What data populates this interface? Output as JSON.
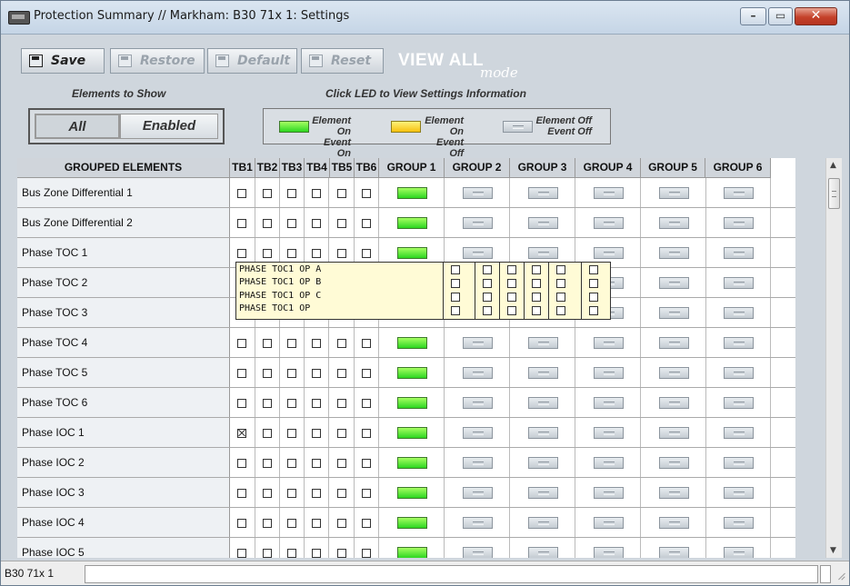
{
  "window": {
    "title": "Protection Summary // Markham: B30 71x 1: Settings",
    "controls": {
      "minimize_icon": "minimize-icon",
      "maximize_icon": "maximize-icon",
      "close_icon": "close-icon"
    }
  },
  "toolbar": {
    "save_label": "Save",
    "restore_label": "Restore",
    "default_label": "Default",
    "reset_label": "Reset",
    "view_all": "VIEW ALL",
    "view_all_mode": "mode"
  },
  "elements_to_show": {
    "label": "Elements to Show",
    "all_label": "All",
    "enabled_label": "Enabled",
    "selected": "All"
  },
  "legend": {
    "header": "Click LED to View Settings Information",
    "items": [
      {
        "line1": "Element On",
        "line2": "Event On",
        "color": "#3bdc2a"
      },
      {
        "line1": "Element On",
        "line2": "Event Off",
        "color": "#f6c10d"
      },
      {
        "line1": "Element Off",
        "line2": "Event Off",
        "color": "#c4cbd2"
      }
    ]
  },
  "table": {
    "columns": {
      "name": "GROUPED ELEMENTS",
      "tb": [
        "TB1",
        "TB2",
        "TB3",
        "TB4",
        "TB5",
        "TB6"
      ],
      "groups": [
        "GROUP 1",
        "GROUP 2",
        "GROUP 3",
        "GROUP 4",
        "GROUP 5",
        "GROUP 6"
      ]
    },
    "rows": [
      {
        "name": "Bus Zone Differential 1",
        "tb_checked": [
          false,
          false,
          false,
          false,
          false,
          false
        ],
        "group_state": [
          "on",
          "off",
          "off",
          "off",
          "off",
          "off"
        ]
      },
      {
        "name": "Bus Zone Differential 2",
        "tb_checked": [
          false,
          false,
          false,
          false,
          false,
          false
        ],
        "group_state": [
          "on",
          "off",
          "off",
          "off",
          "off",
          "off"
        ]
      },
      {
        "name": "Phase TOC 1",
        "tb_checked": [
          false,
          false,
          false,
          false,
          false,
          false
        ],
        "group_state": [
          "on",
          "off",
          "off",
          "off",
          "off",
          "off"
        ]
      },
      {
        "name": "Phase TOC 2",
        "tb_checked": [
          false,
          false,
          false,
          false,
          false,
          false
        ],
        "group_state": [
          "on",
          "off",
          "off",
          "off",
          "off",
          "off"
        ]
      },
      {
        "name": "Phase TOC 3",
        "tb_checked": [
          false,
          false,
          false,
          false,
          false,
          false
        ],
        "group_state": [
          "on",
          "off",
          "off",
          "off",
          "off",
          "off"
        ]
      },
      {
        "name": "Phase TOC 4",
        "tb_checked": [
          false,
          false,
          false,
          false,
          false,
          false
        ],
        "group_state": [
          "on",
          "off",
          "off",
          "off",
          "off",
          "off"
        ]
      },
      {
        "name": "Phase TOC 5",
        "tb_checked": [
          false,
          false,
          false,
          false,
          false,
          false
        ],
        "group_state": [
          "on",
          "off",
          "off",
          "off",
          "off",
          "off"
        ]
      },
      {
        "name": "Phase TOC 6",
        "tb_checked": [
          false,
          false,
          false,
          false,
          false,
          false
        ],
        "group_state": [
          "on",
          "off",
          "off",
          "off",
          "off",
          "off"
        ]
      },
      {
        "name": "Phase IOC 1",
        "tb_checked": [
          true,
          false,
          false,
          false,
          false,
          false
        ],
        "group_state": [
          "on",
          "off",
          "off",
          "off",
          "off",
          "off"
        ]
      },
      {
        "name": "Phase IOC 2",
        "tb_checked": [
          false,
          false,
          false,
          false,
          false,
          false
        ],
        "group_state": [
          "on",
          "off",
          "off",
          "off",
          "off",
          "off"
        ]
      },
      {
        "name": "Phase IOC 3",
        "tb_checked": [
          false,
          false,
          false,
          false,
          false,
          false
        ],
        "group_state": [
          "on",
          "off",
          "off",
          "off",
          "off",
          "off"
        ]
      },
      {
        "name": "Phase IOC 4",
        "tb_checked": [
          false,
          false,
          false,
          false,
          false,
          false
        ],
        "group_state": [
          "on",
          "off",
          "off",
          "off",
          "off",
          "off"
        ]
      },
      {
        "name": "Phase IOC 5",
        "tb_checked": [
          false,
          false,
          false,
          false,
          false,
          false
        ],
        "group_state": [
          "on",
          "off",
          "off",
          "off",
          "off",
          "off"
        ]
      }
    ]
  },
  "tooltip": {
    "lines": [
      "PHASE TOC1 OP A",
      "PHASE TOC1 OP B",
      "PHASE TOC1 OP C",
      "PHASE TOC1 OP"
    ]
  },
  "status": {
    "device": "B30 71x 1",
    "field_value": ""
  }
}
